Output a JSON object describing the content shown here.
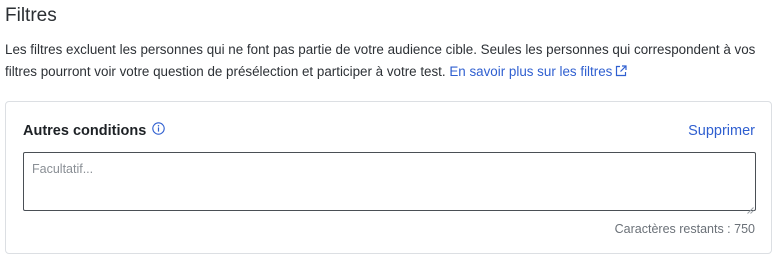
{
  "section": {
    "title": "Filtres",
    "description": "Les filtres excluent les personnes qui ne font pas partie de votre audience cible. Seules les personnes qui correspondent à vos filtres pourront voir votre question de présélection et participer à votre test.",
    "learn_more_label": "En savoir plus sur les filtres",
    "learn_more_icon": "external-link-icon"
  },
  "card": {
    "title": "Autres conditions",
    "info_icon": "info-icon",
    "delete_label": "Supprimer",
    "textarea": {
      "value": "",
      "placeholder": "Facultatif..."
    },
    "char_count_label": "Caractères restants : 750"
  },
  "colors": {
    "link": "#2f5fd0",
    "text": "#2d3136",
    "muted": "#6b7178",
    "border": "#dcdfe3"
  }
}
